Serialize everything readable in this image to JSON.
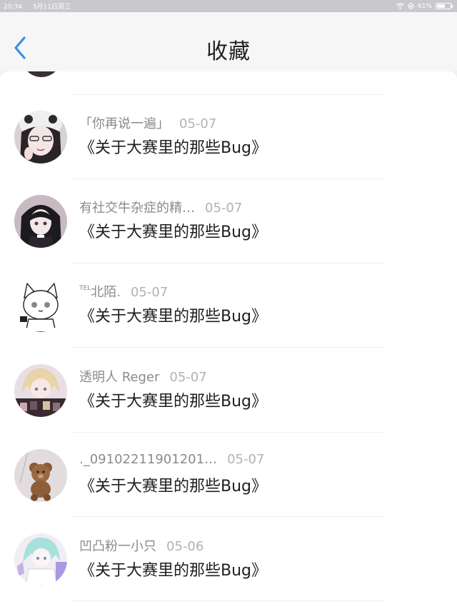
{
  "status_bar": {
    "time": "20:34",
    "date": "5月11日周三",
    "battery": "61%",
    "battery_level": 0.61
  },
  "header": {
    "title": "收藏"
  },
  "favorites": [
    {
      "name": "「你再说一遍」",
      "date": "05-07",
      "title": "《关于大赛里的那些Bug》"
    },
    {
      "name": "有社交牛杂症的精…",
      "date": "05-07",
      "title": "《关于大赛里的那些Bug》"
    },
    {
      "name_prefix": "TEL",
      "name": "北陌.",
      "date": "05-07",
      "title": "《关于大赛里的那些Bug》"
    },
    {
      "name": "透明人 Reger",
      "date": "05-07",
      "title": "《关于大赛里的那些Bug》"
    },
    {
      "name": "._09102211901201…",
      "date": "05-07",
      "title": "《关于大赛里的那些Bug》"
    },
    {
      "name": "凹凸粉一小只",
      "date": "05-06",
      "title": "《关于大赛里的那些Bug》"
    }
  ],
  "colors": {
    "accent": "#3b8fe0",
    "status_bar": "#c9c9cd"
  }
}
